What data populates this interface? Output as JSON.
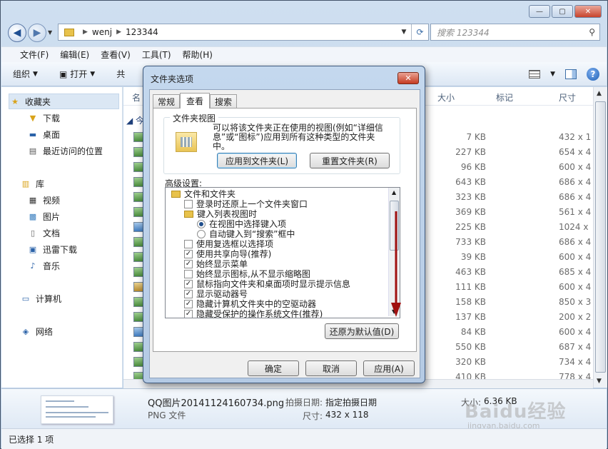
{
  "explorer": {
    "caption_buttons": {
      "minimize": "—",
      "maximize": "▢",
      "close": "✕"
    },
    "address": {
      "segments": [
        "wenj",
        "123344"
      ]
    },
    "search": {
      "placeholder": "搜索 123344",
      "icon": "search-icon"
    },
    "menu": [
      "文件(F)",
      "编辑(E)",
      "查看(V)",
      "工具(T)",
      "帮助(H)"
    ],
    "toolbar": {
      "organize": "组织",
      "open": "打开",
      "share_partial": "共"
    },
    "nav": {
      "favorites": "收藏夹",
      "downloads": "下载",
      "desktop": "桌面",
      "recent": "最近访问的位置",
      "libraries": "库",
      "videos": "视频",
      "pictures": "图片",
      "documents": "文档",
      "thunder": "迅雷下载",
      "music": "音乐",
      "computer": "计算机",
      "network": "网络"
    },
    "columns": {
      "name": "名",
      "size": "大小",
      "tags": "标记",
      "dimensions": "尺寸"
    },
    "group_partial": "今",
    "rows": [
      {
        "type": "png",
        "size": "7 KB",
        "dim": "432 x 1"
      },
      {
        "type": "png",
        "size": "227 KB",
        "dim": "654 x 4"
      },
      {
        "type": "png",
        "size": "96 KB",
        "dim": "600 x 4"
      },
      {
        "type": "png",
        "size": "643 KB",
        "dim": "686 x 4"
      },
      {
        "type": "png",
        "size": "323 KB",
        "dim": "686 x 4"
      },
      {
        "type": "png",
        "size": "369 KB",
        "dim": "561 x 4"
      },
      {
        "type": "jpg",
        "size": "225 KB",
        "dim": "1024 x"
      },
      {
        "type": "png",
        "size": "733 KB",
        "dim": "686 x 4"
      },
      {
        "type": "png",
        "size": "39 KB",
        "dim": "600 x 4"
      },
      {
        "type": "png",
        "size": "463 KB",
        "dim": "685 x 4"
      },
      {
        "type": "gif",
        "size": "111 KB",
        "dim": "600 x 4"
      },
      {
        "type": "png",
        "size": "158 KB",
        "dim": "850 x 3"
      },
      {
        "type": "png",
        "size": "137 KB",
        "dim": "200 x 2"
      },
      {
        "type": "jpg",
        "size": "84 KB",
        "dim": "600 x 4"
      },
      {
        "type": "png",
        "size": "550 KB",
        "dim": "687 x 4"
      },
      {
        "type": "png",
        "size": "320 KB",
        "dim": "734 x 4"
      },
      {
        "type": "png",
        "size": "410 KB",
        "dim": "778 x 4"
      }
    ],
    "details": {
      "filename": "QQ图片20141124160734.png",
      "filetype": "PNG 文件",
      "date_label": "拍摄日期:",
      "date_value": "指定拍摄日期",
      "size_label": "大小:",
      "size_value": "6.36 KB",
      "dim_label": "尺寸:",
      "dim_value": "432 x 118"
    },
    "status": "已选择 1 项",
    "watermark": "Baidu经验",
    "watermark_url": "jingyan.baidu.com"
  },
  "dialog": {
    "title": "文件夹选项",
    "close": "✕",
    "tabs": [
      "常规",
      "查看",
      "搜索"
    ],
    "active_tab": 1,
    "folder_view": {
      "legend": "文件夹视图",
      "description": "可以将该文件夹正在使用的视图(例如“详细信息”或“图标”)应用到所有这种类型的文件夹中。",
      "apply_button": "应用到文件夹(L)",
      "reset_button": "重置文件夹(R)"
    },
    "advanced_label": "高级设置:",
    "tree": [
      {
        "kind": "folder",
        "label": "文件和文件夹",
        "checked": false
      },
      {
        "kind": "check",
        "label": "登录时还原上一个文件夹窗口",
        "checked": false
      },
      {
        "kind": "folder",
        "label": "键入列表视图时",
        "checked": false
      },
      {
        "kind": "radio",
        "label": "在视图中选择键入项",
        "checked": true
      },
      {
        "kind": "radio",
        "label": "自动键入到“搜索”框中",
        "checked": false
      },
      {
        "kind": "check",
        "label": "使用复选框以选择项",
        "checked": false
      },
      {
        "kind": "check",
        "label": "使用共享向导(推荐)",
        "checked": true
      },
      {
        "kind": "check",
        "label": "始终显示菜单",
        "checked": true
      },
      {
        "kind": "check",
        "label": "始终显示图标,从不显示缩略图",
        "checked": false
      },
      {
        "kind": "check",
        "label": "鼠标指向文件夹和桌面项时显示提示信息",
        "checked": true
      },
      {
        "kind": "check",
        "label": "显示驱动器号",
        "checked": true
      },
      {
        "kind": "check",
        "label": "隐藏计算机文件夹中的空驱动器",
        "checked": true
      },
      {
        "kind": "check",
        "label": "隐藏受保护的操作系统文件(推荐)",
        "checked": true
      }
    ],
    "restore_button": "还原为默认值(D)",
    "ok": "确定",
    "cancel": "取消",
    "apply": "应用(A)"
  },
  "colors": {
    "annotation_arrow": "#a01010",
    "accent": "#3c7fb1"
  }
}
